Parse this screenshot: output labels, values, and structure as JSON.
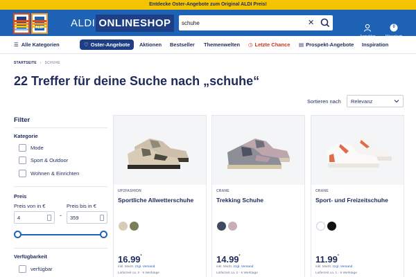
{
  "promo_banner": "Entdecke Oster-Angebote zum Original ALDI Preis!",
  "header": {
    "logo_text": "ALDI",
    "shop_title_light": "ALDI",
    "shop_title_bold": "ONLINESHOP",
    "search": {
      "value": "schuhe"
    },
    "account_label": "Anmelden",
    "cart_label": "Warenkorb",
    "cart_count": "0"
  },
  "nav": {
    "all_categories": "Alle Kategorien",
    "items": [
      "Oster-Angebote",
      "Aktionen",
      "Bestseller",
      "Themenwelten",
      "Letzte Chance",
      "Prospekt-Angebote",
      "Inspiration"
    ]
  },
  "breadcrumb": {
    "home": "STARTSEITE",
    "current": "SCHUHE"
  },
  "page_title": "22 Treffer für deine Suche nach „schuhe“",
  "sort": {
    "label": "Sortieren nach",
    "value": "Relevanz"
  },
  "filter": {
    "title": "Filter",
    "category_title": "Kategorie",
    "categories": [
      "Mode",
      "Sport & Outdoor",
      "Wohnen & Einrichten"
    ],
    "price_title": "Preis",
    "price_from_label": "Preis von in €",
    "price_to_label": "Preis bis in €",
    "price_from": "4",
    "price_to": "359",
    "availability_title": "Verfügbarkeit",
    "availability_option": "verfügbar"
  },
  "products": [
    {
      "brand": "UP2FASHION",
      "name": "Sportliche Allwetterschuhe",
      "price": "16.99",
      "price_mark": "*",
      "vat_text": "inkl. MwSt. ",
      "shipping_link": "zzgl. Versand",
      "delivery": "Lieferzeit ca. 2 - 5 Werktage",
      "swatches": [
        "#d8cbb8",
        "#7b7e5a"
      ]
    },
    {
      "brand": "CRANE",
      "name": "Trekking Schuhe",
      "price": "14.99",
      "price_mark": "*",
      "vat_text": "inkl. MwSt. ",
      "shipping_link": "zzgl. Versand",
      "delivery": "Lieferzeit ca. 2 - 5 Werktage",
      "swatches": [
        "#3f4a5e",
        "#c9aeb9"
      ]
    },
    {
      "brand": "CRANE",
      "name": "Sport- und Freizeitschuhe",
      "price": "11.99",
      "price_mark": "*",
      "vat_text": "inkl. MwSt. ",
      "shipping_link": "zzgl. Versand",
      "delivery": "Lieferzeit ca. 1 - 5 Werktage",
      "swatches": [
        "#ffffff",
        "#111111"
      ]
    }
  ],
  "colors": {
    "brand_blue": "#1e62b6",
    "dark_blue": "#1e3f86",
    "text_navy": "#1e2a5a",
    "promo_yellow": "#f5c400",
    "alert_red": "#d0311f"
  }
}
